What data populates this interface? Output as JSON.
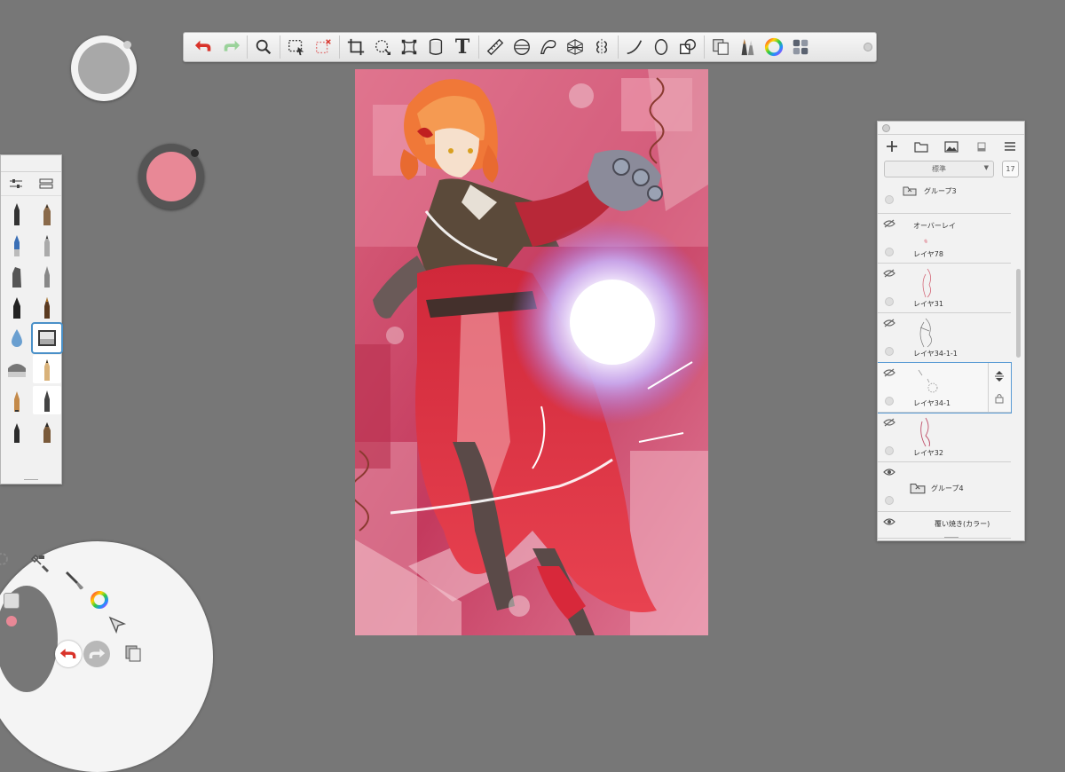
{
  "toolbar": {
    "tools": [
      {
        "icon": "undo-icon",
        "label": "Undo"
      },
      {
        "icon": "redo-icon",
        "label": "Redo"
      },
      {
        "icon": "zoom-icon",
        "label": "Zoom"
      },
      {
        "icon": "selection-icon",
        "label": "Selection"
      },
      {
        "icon": "selection-clear-icon",
        "label": "Clear selection"
      },
      {
        "icon": "crop-icon",
        "label": "Crop"
      },
      {
        "icon": "transform-icon",
        "label": "Transform"
      },
      {
        "icon": "distort-icon",
        "label": "Distort"
      },
      {
        "icon": "fill-icon",
        "label": "Fill"
      },
      {
        "icon": "text-icon",
        "label": "Text"
      },
      {
        "icon": "ruler-icon",
        "label": "Ruler"
      },
      {
        "icon": "ellipse-guide-icon",
        "label": "Ellipse guide"
      },
      {
        "icon": "french-curve-icon",
        "label": "French curve"
      },
      {
        "icon": "perspective-icon",
        "label": "Perspective"
      },
      {
        "icon": "symmetry-icon",
        "label": "Symmetry"
      },
      {
        "icon": "stroke-tool-icon",
        "label": "Stroke"
      },
      {
        "icon": "shape-icon",
        "label": "Shape"
      },
      {
        "icon": "layer-tool-icon",
        "label": "Layer tool"
      },
      {
        "icon": "copy-paste-icon",
        "label": "Copy"
      },
      {
        "icon": "brushes-icon",
        "label": "Brushes"
      },
      {
        "icon": "color-wheel-icon",
        "label": "Color"
      },
      {
        "icon": "layout-icon",
        "label": "Layout"
      }
    ],
    "text_glyph": "T"
  },
  "colors": {
    "current_color": "#e88896",
    "accent": "#4a90c8",
    "undo": "#d9332a",
    "redo": "#9ad29a"
  },
  "layers": {
    "blend_mode": "標準",
    "opacity": "17",
    "items": [
      {
        "name": "グループ3",
        "type": "group",
        "visible": "",
        "hidden": false
      },
      {
        "name": "オーバーレイ",
        "type": "label",
        "visible": "",
        "hidden": true
      },
      {
        "name": "レイヤ78",
        "type": "layer",
        "hidden": true
      },
      {
        "name": "レイヤ31",
        "type": "layer",
        "hidden": true
      },
      {
        "name": "レイヤ34-1-1",
        "type": "layer",
        "hidden": true
      },
      {
        "name": "レイヤ34-1",
        "type": "layer",
        "hidden": true,
        "active": true
      },
      {
        "name": "レイヤ32",
        "type": "layer",
        "hidden": true
      },
      {
        "name": "グループ4",
        "type": "group",
        "hidden": false
      },
      {
        "name": "覆い焼き(カラー)",
        "type": "layer",
        "hidden": false
      }
    ]
  }
}
